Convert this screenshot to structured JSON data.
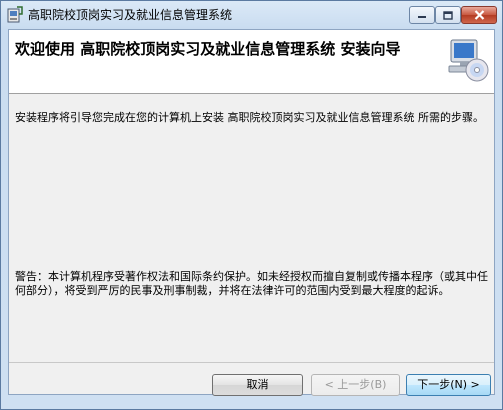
{
  "window": {
    "title": "高职院校顶岗实习及就业信息管理系统"
  },
  "header": {
    "title": "欢迎使用 高职院校顶岗实习及就业信息管理系统 安装向导",
    "icon": "installer-computer-icon"
  },
  "body": {
    "intro": "安装程序将引导您完成在您的计算机上安装 高职院校顶岗实习及就业信息管理系统 所需的步骤。",
    "warning": "警告：本计算机程序受著作权法和国际条约保护。如未经授权而擅自复制或传播本程序（或其中任何部分），将受到严厉的民事及刑事制裁，并将在法律许可的范围内受到最大程度的起诉。"
  },
  "buttons": {
    "cancel": "取消",
    "back": "< 上一步(B)",
    "next": "下一步(N) >"
  },
  "colors": {
    "titlebar": "#cfe0f2",
    "close_button": "#c8573f",
    "header_bg": "#ffffff",
    "content_bg": "#f0f0f0"
  }
}
